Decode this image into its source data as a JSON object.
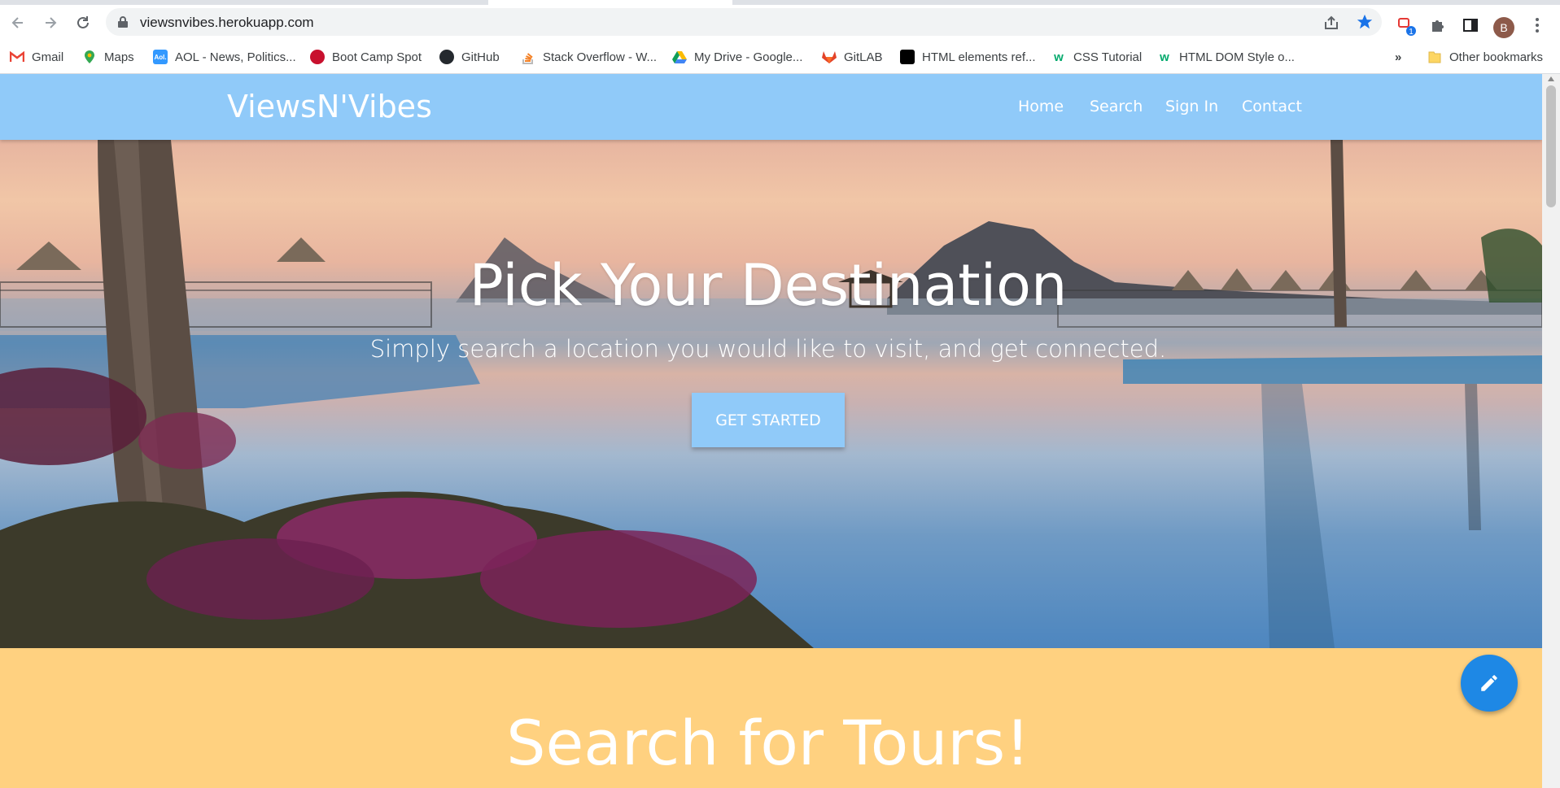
{
  "browser": {
    "url": "viewsnvibes.herokuapp.com",
    "extension_badge": "1",
    "avatar_letter": "B",
    "bookmarks": [
      {
        "label": "Gmail",
        "icon": "gmail-icon"
      },
      {
        "label": "Maps",
        "icon": "maps-icon"
      },
      {
        "label": "AOL - News, Politics...",
        "icon": "aol-icon",
        "icon_text": "Aol."
      },
      {
        "label": "Boot Camp Spot",
        "icon": "bootcamp-icon"
      },
      {
        "label": "GitHub",
        "icon": "github-icon"
      },
      {
        "label": "Stack Overflow - W...",
        "icon": "stackoverflow-icon"
      },
      {
        "label": "My Drive - Google...",
        "icon": "drive-icon"
      },
      {
        "label": "GitLAB",
        "icon": "gitlab-icon"
      },
      {
        "label": "HTML elements ref...",
        "icon": "html-icon"
      },
      {
        "label": "CSS Tutorial",
        "icon": "w3schools-icon",
        "icon_text": "w"
      },
      {
        "label": "HTML DOM Style o...",
        "icon": "w3schools-icon",
        "icon_text": "w"
      }
    ],
    "overflow_label": "»",
    "other_bookmarks": "Other bookmarks"
  },
  "navbar": {
    "brand": "ViewsN'Vibes",
    "links": [
      "Home",
      "Search",
      "Sign In",
      "Contact"
    ]
  },
  "hero": {
    "title": "Pick Your Destination",
    "subtitle": "Simply search a location you would like to visit, and get connected.",
    "cta": "GET STARTED"
  },
  "tours": {
    "title": "Search for Tours!"
  },
  "colors": {
    "navbar": "#90caf9",
    "tours_bg": "#ffd180",
    "fab": "#1e88e5"
  }
}
